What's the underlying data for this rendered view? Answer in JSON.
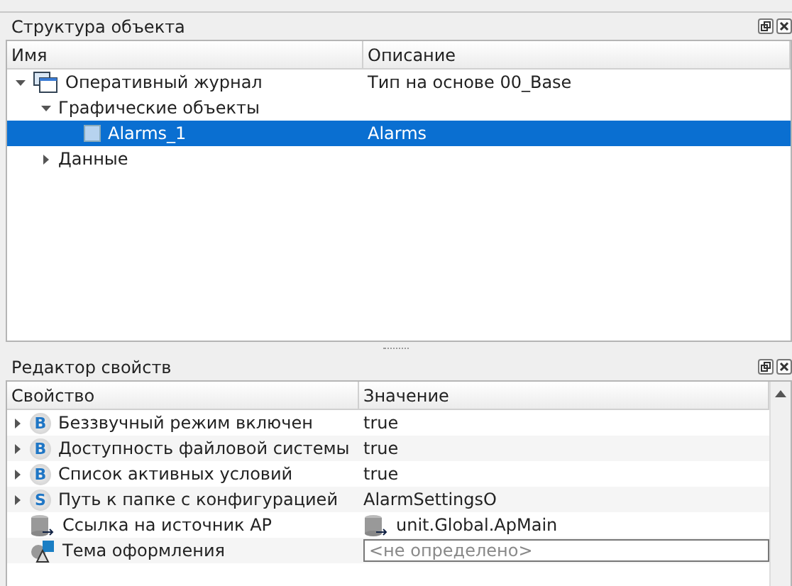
{
  "structure_panel": {
    "title": "Структура объекта",
    "columns": [
      "Имя",
      "Описание"
    ],
    "tree": [
      {
        "kind": "journal",
        "label": "Оперативный журнал",
        "description": "Тип на основе 00_Base",
        "expanded": true,
        "selected": false,
        "children": [
          {
            "label": "Графические объекты",
            "expanded": true,
            "selected": false,
            "children": [
              {
                "kind": "object",
                "label": "Alarms_1",
                "description": "Alarms",
                "selected": true
              }
            ]
          },
          {
            "label": "Данные",
            "expanded": false,
            "selected": false
          }
        ]
      }
    ]
  },
  "properties_panel": {
    "title": "Редактор свойств",
    "columns": [
      "Свойство",
      "Значение"
    ],
    "rows": [
      {
        "kind": "letter",
        "badge": "B",
        "name": "Беззвучный режим включен",
        "expandable": true,
        "value": "true"
      },
      {
        "kind": "letter",
        "badge": "B",
        "name": "Доступность файловой системы",
        "expandable": true,
        "value": "true"
      },
      {
        "kind": "letter",
        "badge": "B",
        "name": "Список активных условий",
        "expandable": true,
        "value": "true"
      },
      {
        "kind": "letter",
        "badge": "S",
        "name": "Путь к папке с конфигурацией",
        "expandable": true,
        "value": "AlarmSettingsO"
      },
      {
        "kind": "source",
        "name": "Ссылка на источник АР",
        "expandable": false,
        "value": "unit.Global.ApMain",
        "value_icon": true
      },
      {
        "kind": "theme",
        "name": "Тема оформления",
        "expandable": false,
        "placeholder": "<не определено>"
      }
    ]
  }
}
